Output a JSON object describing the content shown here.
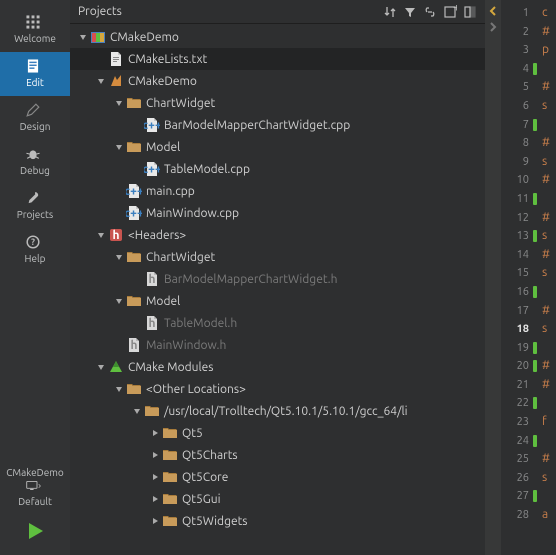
{
  "sidebar": {
    "items": [
      {
        "id": "welcome",
        "label": "Welcome"
      },
      {
        "id": "edit",
        "label": "Edit"
      },
      {
        "id": "design",
        "label": "Design"
      },
      {
        "id": "debug",
        "label": "Debug"
      },
      {
        "id": "projects",
        "label": "Projects"
      },
      {
        "id": "help",
        "label": "Help"
      }
    ],
    "kit": {
      "project": "CMakeDemo",
      "config": "Default"
    }
  },
  "panel": {
    "title": "Projects"
  },
  "tree": [
    {
      "depth": 0,
      "toggle": "open",
      "icon": "project",
      "text": "CMakeDemo"
    },
    {
      "depth": 1,
      "toggle": "none",
      "icon": "file-txt",
      "text": "CMakeLists.txt",
      "selected": true
    },
    {
      "depth": 1,
      "toggle": "open",
      "icon": "section",
      "text": "CMakeDemo"
    },
    {
      "depth": 2,
      "toggle": "open",
      "icon": "folder",
      "text": "ChartWidget"
    },
    {
      "depth": 3,
      "toggle": "none",
      "icon": "file-cpp",
      "text": "BarModelMapperChartWidget.cpp"
    },
    {
      "depth": 2,
      "toggle": "open",
      "icon": "folder",
      "text": "Model"
    },
    {
      "depth": 3,
      "toggle": "none",
      "icon": "file-cpp",
      "text": "TableModel.cpp"
    },
    {
      "depth": 2,
      "toggle": "none",
      "icon": "file-cpp",
      "text": "main.cpp"
    },
    {
      "depth": 2,
      "toggle": "none",
      "icon": "file-cpp",
      "text": "MainWindow.cpp"
    },
    {
      "depth": 1,
      "toggle": "open",
      "icon": "headers",
      "text": "<Headers>"
    },
    {
      "depth": 2,
      "toggle": "open",
      "icon": "folder",
      "text": "ChartWidget"
    },
    {
      "depth": 3,
      "toggle": "none",
      "icon": "file-h",
      "text": "BarModelMapperChartWidget.h",
      "dim": true
    },
    {
      "depth": 2,
      "toggle": "open",
      "icon": "folder",
      "text": "Model"
    },
    {
      "depth": 3,
      "toggle": "none",
      "icon": "file-h",
      "text": "TableModel.h",
      "dim": true
    },
    {
      "depth": 2,
      "toggle": "none",
      "icon": "file-h",
      "text": "MainWindow.h",
      "dim": true
    },
    {
      "depth": 1,
      "toggle": "open",
      "icon": "cmake",
      "text": "CMake Modules"
    },
    {
      "depth": 2,
      "toggle": "open",
      "icon": "folder",
      "text": "<Other Locations>"
    },
    {
      "depth": 3,
      "toggle": "open",
      "icon": "folder",
      "text": "/usr/local/Trolltech/Qt5.10.1/5.10.1/gcc_64/li"
    },
    {
      "depth": 4,
      "toggle": "closed",
      "icon": "folder",
      "text": "Qt5"
    },
    {
      "depth": 4,
      "toggle": "closed",
      "icon": "folder",
      "text": "Qt5Charts"
    },
    {
      "depth": 4,
      "toggle": "closed",
      "icon": "folder",
      "text": "Qt5Core"
    },
    {
      "depth": 4,
      "toggle": "closed",
      "icon": "folder",
      "text": "Qt5Gui"
    },
    {
      "depth": 4,
      "toggle": "closed",
      "icon": "folder",
      "text": "Qt5Widgets"
    }
  ],
  "editor": {
    "lines": [
      {
        "n": 1,
        "mark": false,
        "t": "c"
      },
      {
        "n": 2,
        "mark": false,
        "t": "#"
      },
      {
        "n": 3,
        "mark": false,
        "t": "p"
      },
      {
        "n": 4,
        "mark": true,
        "t": ""
      },
      {
        "n": 5,
        "mark": false,
        "t": "#"
      },
      {
        "n": 6,
        "mark": false,
        "t": "s"
      },
      {
        "n": 7,
        "mark": true,
        "t": ""
      },
      {
        "n": 8,
        "mark": false,
        "t": "#"
      },
      {
        "n": 9,
        "mark": false,
        "t": "s"
      },
      {
        "n": 10,
        "mark": false,
        "t": "#"
      },
      {
        "n": 11,
        "mark": true,
        "t": ""
      },
      {
        "n": 12,
        "mark": false,
        "t": "#"
      },
      {
        "n": 13,
        "mark": true,
        "t": "s"
      },
      {
        "n": 14,
        "mark": false,
        "t": "#"
      },
      {
        "n": 15,
        "mark": false,
        "t": "s"
      },
      {
        "n": 16,
        "mark": true,
        "t": ""
      },
      {
        "n": 17,
        "mark": false,
        "t": "#"
      },
      {
        "n": 18,
        "mark": false,
        "t": "s",
        "current": true
      },
      {
        "n": 19,
        "mark": true,
        "t": ""
      },
      {
        "n": 20,
        "mark": true,
        "t": "#"
      },
      {
        "n": 21,
        "mark": false,
        "t": "#"
      },
      {
        "n": 22,
        "mark": true,
        "t": ""
      },
      {
        "n": 23,
        "mark": false,
        "t": "f"
      },
      {
        "n": 24,
        "mark": true,
        "t": ""
      },
      {
        "n": 25,
        "mark": false,
        "t": "#"
      },
      {
        "n": 26,
        "mark": false,
        "t": "s"
      },
      {
        "n": 27,
        "mark": true,
        "t": ""
      },
      {
        "n": 28,
        "mark": false,
        "t": "a"
      }
    ]
  }
}
